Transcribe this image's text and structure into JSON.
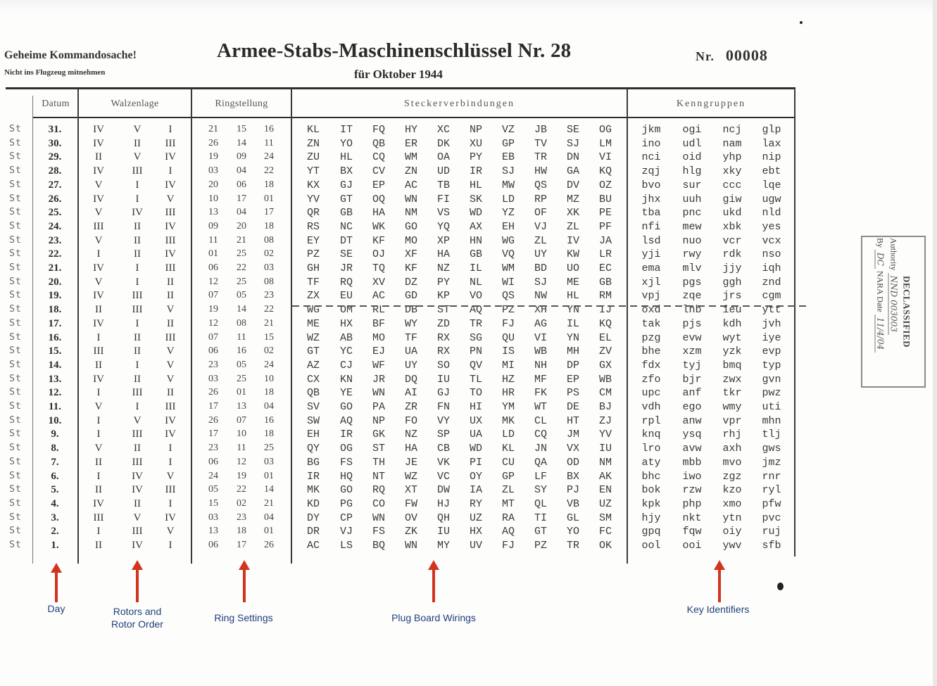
{
  "header": {
    "classification": "Geheime Kommandosache!",
    "notice": "Nicht ins Flugzeug mitnehmen",
    "title": "Armee-Stabs-Maschinenschlüssel Nr. 28",
    "subtitle": "für Oktober 1944",
    "number_label": "Nr.",
    "number_value": "00008"
  },
  "table": {
    "headers": {
      "datum": "Datum",
      "walzenlage": "Walzenlage",
      "ringstellung": "Ringstellung",
      "steckerverbindungen": "Steckerverbindungen",
      "kenngruppen": "Kenngruppen"
    },
    "row_prefix": "St",
    "rows": [
      {
        "day": "31.",
        "rotors": [
          "IV",
          "V",
          "I"
        ],
        "rings": [
          "21",
          "15",
          "16"
        ],
        "plugs": [
          "KL",
          "IT",
          "FQ",
          "HY",
          "XC",
          "NP",
          "VZ",
          "JB",
          "SE",
          "OG"
        ],
        "kenn": [
          "jkm",
          "ogi",
          "ncj",
          "glp"
        ]
      },
      {
        "day": "30.",
        "rotors": [
          "IV",
          "II",
          "III"
        ],
        "rings": [
          "26",
          "14",
          "11"
        ],
        "plugs": [
          "ZN",
          "YO",
          "QB",
          "ER",
          "DK",
          "XU",
          "GP",
          "TV",
          "SJ",
          "LM"
        ],
        "kenn": [
          "ino",
          "udl",
          "nam",
          "lax"
        ]
      },
      {
        "day": "29.",
        "rotors": [
          "II",
          "V",
          "IV"
        ],
        "rings": [
          "19",
          "09",
          "24"
        ],
        "plugs": [
          "ZU",
          "HL",
          "CQ",
          "WM",
          "OA",
          "PY",
          "EB",
          "TR",
          "DN",
          "VI"
        ],
        "kenn": [
          "nci",
          "oid",
          "yhp",
          "nip"
        ]
      },
      {
        "day": "28.",
        "rotors": [
          "IV",
          "III",
          "I"
        ],
        "rings": [
          "03",
          "04",
          "22"
        ],
        "plugs": [
          "YT",
          "BX",
          "CV",
          "ZN",
          "UD",
          "IR",
          "SJ",
          "HW",
          "GA",
          "KQ"
        ],
        "kenn": [
          "zqj",
          "hlg",
          "xky",
          "ebt"
        ]
      },
      {
        "day": "27.",
        "rotors": [
          "V",
          "I",
          "IV"
        ],
        "rings": [
          "20",
          "06",
          "18"
        ],
        "plugs": [
          "KX",
          "GJ",
          "EP",
          "AC",
          "TB",
          "HL",
          "MW",
          "QS",
          "DV",
          "OZ"
        ],
        "kenn": [
          "bvo",
          "sur",
          "ccc",
          "lqe"
        ]
      },
      {
        "day": "26.",
        "rotors": [
          "IV",
          "I",
          "V"
        ],
        "rings": [
          "10",
          "17",
          "01"
        ],
        "plugs": [
          "YV",
          "GT",
          "OQ",
          "WN",
          "FI",
          "SK",
          "LD",
          "RP",
          "MZ",
          "BU"
        ],
        "kenn": [
          "jhx",
          "uuh",
          "giw",
          "ugw"
        ]
      },
      {
        "day": "25.",
        "rotors": [
          "V",
          "IV",
          "III"
        ],
        "rings": [
          "13",
          "04",
          "17"
        ],
        "plugs": [
          "QR",
          "GB",
          "HA",
          "NM",
          "VS",
          "WD",
          "YZ",
          "OF",
          "XK",
          "PE"
        ],
        "kenn": [
          "tba",
          "pnc",
          "ukd",
          "nld"
        ]
      },
      {
        "day": "24.",
        "rotors": [
          "III",
          "II",
          "IV"
        ],
        "rings": [
          "09",
          "20",
          "18"
        ],
        "plugs": [
          "RS",
          "NC",
          "WK",
          "GO",
          "YQ",
          "AX",
          "EH",
          "VJ",
          "ZL",
          "PF"
        ],
        "kenn": [
          "nfi",
          "mew",
          "xbk",
          "yes"
        ]
      },
      {
        "day": "23.",
        "rotors": [
          "V",
          "II",
          "III"
        ],
        "rings": [
          "11",
          "21",
          "08"
        ],
        "plugs": [
          "EY",
          "DT",
          "KF",
          "MO",
          "XP",
          "HN",
          "WG",
          "ZL",
          "IV",
          "JA"
        ],
        "kenn": [
          "lsd",
          "nuo",
          "vcr",
          "vcx"
        ]
      },
      {
        "day": "22.",
        "rotors": [
          "I",
          "II",
          "IV"
        ],
        "rings": [
          "01",
          "25",
          "02"
        ],
        "plugs": [
          "PZ",
          "SE",
          "OJ",
          "XF",
          "HA",
          "GB",
          "VQ",
          "UY",
          "KW",
          "LR"
        ],
        "kenn": [
          "yji",
          "rwy",
          "rdk",
          "nso"
        ]
      },
      {
        "day": "21.",
        "rotors": [
          "IV",
          "I",
          "III"
        ],
        "rings": [
          "06",
          "22",
          "03"
        ],
        "plugs": [
          "GH",
          "JR",
          "TQ",
          "KF",
          "NZ",
          "IL",
          "WM",
          "BD",
          "UO",
          "EC"
        ],
        "kenn": [
          "ema",
          "mlv",
          "jjy",
          "iqh"
        ]
      },
      {
        "day": "20.",
        "rotors": [
          "V",
          "I",
          "II"
        ],
        "rings": [
          "12",
          "25",
          "08"
        ],
        "plugs": [
          "TF",
          "RQ",
          "XV",
          "DZ",
          "PY",
          "NL",
          "WI",
          "SJ",
          "ME",
          "GB"
        ],
        "kenn": [
          "xjl",
          "pgs",
          "ggh",
          "znd"
        ]
      },
      {
        "day": "19.",
        "rotors": [
          "IV",
          "III",
          "II"
        ],
        "rings": [
          "07",
          "05",
          "23"
        ],
        "plugs": [
          "ZX",
          "EU",
          "AC",
          "GD",
          "KP",
          "VO",
          "QS",
          "NW",
          "HL",
          "RM"
        ],
        "kenn": [
          "vpj",
          "zqe",
          "jrs",
          "cgm"
        ]
      },
      {
        "day": "18.",
        "rotors": [
          "II",
          "III",
          "V"
        ],
        "rings": [
          "19",
          "14",
          "22"
        ],
        "plugs": [
          "WG",
          "OM",
          "RL",
          "DB",
          "ST",
          "AQ",
          "PZ",
          "XH",
          "YN",
          "IJ"
        ],
        "kenn": [
          "oxd",
          "lnb",
          "ieu",
          "ytt"
        ]
      },
      {
        "day": "17.",
        "rotors": [
          "IV",
          "I",
          "II"
        ],
        "rings": [
          "12",
          "08",
          "21"
        ],
        "plugs": [
          "ME",
          "HX",
          "BF",
          "WY",
          "ZD",
          "TR",
          "FJ",
          "AG",
          "IL",
          "KQ"
        ],
        "kenn": [
          "tak",
          "pjs",
          "kdh",
          "jvh"
        ]
      },
      {
        "day": "16.",
        "rotors": [
          "I",
          "II",
          "III"
        ],
        "rings": [
          "07",
          "11",
          "15"
        ],
        "plugs": [
          "WZ",
          "AB",
          "MO",
          "TF",
          "RX",
          "SG",
          "QU",
          "VI",
          "YN",
          "EL"
        ],
        "kenn": [
          "pzg",
          "evw",
          "wyt",
          "iye"
        ]
      },
      {
        "day": "15.",
        "rotors": [
          "III",
          "II",
          "V"
        ],
        "rings": [
          "06",
          "16",
          "02"
        ],
        "plugs": [
          "GT",
          "YC",
          "EJ",
          "UA",
          "RX",
          "PN",
          "IS",
          "WB",
          "MH",
          "ZV"
        ],
        "kenn": [
          "bhe",
          "xzm",
          "yzk",
          "evp"
        ]
      },
      {
        "day": "14.",
        "rotors": [
          "II",
          "I",
          "V"
        ],
        "rings": [
          "23",
          "05",
          "24"
        ],
        "plugs": [
          "AZ",
          "CJ",
          "WF",
          "UY",
          "SO",
          "QV",
          "MI",
          "NH",
          "DP",
          "GX"
        ],
        "kenn": [
          "fdx",
          "tyj",
          "bmq",
          "typ"
        ]
      },
      {
        "day": "13.",
        "rotors": [
          "IV",
          "II",
          "V"
        ],
        "rings": [
          "03",
          "25",
          "10"
        ],
        "plugs": [
          "CX",
          "KN",
          "JR",
          "DQ",
          "IU",
          "TL",
          "HZ",
          "MF",
          "EP",
          "WB"
        ],
        "kenn": [
          "zfo",
          "bjr",
          "zwx",
          "gvn"
        ]
      },
      {
        "day": "12.",
        "rotors": [
          "I",
          "III",
          "II"
        ],
        "rings": [
          "26",
          "01",
          "18"
        ],
        "plugs": [
          "QB",
          "YE",
          "WN",
          "AI",
          "GJ",
          "TO",
          "HR",
          "FK",
          "PS",
          "CM"
        ],
        "kenn": [
          "upc",
          "anf",
          "tkr",
          "pwz"
        ]
      },
      {
        "day": "11.",
        "rotors": [
          "V",
          "I",
          "III"
        ],
        "rings": [
          "17",
          "13",
          "04"
        ],
        "plugs": [
          "SV",
          "GO",
          "PA",
          "ZR",
          "FN",
          "HI",
          "YM",
          "WT",
          "DE",
          "BJ"
        ],
        "kenn": [
          "vdh",
          "ego",
          "wmy",
          "uti"
        ]
      },
      {
        "day": "10.",
        "rotors": [
          "I",
          "V",
          "IV"
        ],
        "rings": [
          "26",
          "07",
          "16"
        ],
        "plugs": [
          "SW",
          "AQ",
          "NP",
          "FO",
          "VY",
          "UX",
          "MK",
          "CL",
          "HT",
          "ZJ"
        ],
        "kenn": [
          "rpl",
          "anw",
          "vpr",
          "mhn"
        ]
      },
      {
        "day": "9.",
        "rotors": [
          "I",
          "III",
          "IV"
        ],
        "rings": [
          "17",
          "10",
          "18"
        ],
        "plugs": [
          "EH",
          "IR",
          "GK",
          "NZ",
          "SP",
          "UA",
          "LD",
          "CQ",
          "JM",
          "YV"
        ],
        "kenn": [
          "knq",
          "ysq",
          "rhj",
          "tlj"
        ]
      },
      {
        "day": "8.",
        "rotors": [
          "V",
          "II",
          "I"
        ],
        "rings": [
          "23",
          "11",
          "25"
        ],
        "plugs": [
          "QY",
          "OG",
          "ST",
          "HA",
          "CB",
          "WD",
          "KL",
          "JN",
          "VX",
          "IU"
        ],
        "kenn": [
          "lro",
          "avw",
          "axh",
          "gws"
        ]
      },
      {
        "day": "7.",
        "rotors": [
          "II",
          "III",
          "I"
        ],
        "rings": [
          "06",
          "12",
          "03"
        ],
        "plugs": [
          "BG",
          "FS",
          "TH",
          "JE",
          "VK",
          "PI",
          "CU",
          "QA",
          "OD",
          "NM"
        ],
        "kenn": [
          "aty",
          "mbb",
          "mvo",
          "jmz"
        ]
      },
      {
        "day": "6.",
        "rotors": [
          "I",
          "IV",
          "V"
        ],
        "rings": [
          "24",
          "19",
          "01"
        ],
        "plugs": [
          "IR",
          "HQ",
          "NT",
          "WZ",
          "VC",
          "OY",
          "GP",
          "LF",
          "BX",
          "AK"
        ],
        "kenn": [
          "bhc",
          "iwo",
          "zgz",
          "rnr"
        ]
      },
      {
        "day": "5.",
        "rotors": [
          "II",
          "IV",
          "III"
        ],
        "rings": [
          "05",
          "22",
          "14"
        ],
        "plugs": [
          "MK",
          "GO",
          "RQ",
          "XT",
          "DW",
          "IA",
          "ZL",
          "SY",
          "PJ",
          "EN"
        ],
        "kenn": [
          "bok",
          "rzw",
          "kzo",
          "ryl"
        ]
      },
      {
        "day": "4.",
        "rotors": [
          "IV",
          "II",
          "I"
        ],
        "rings": [
          "15",
          "02",
          "21"
        ],
        "plugs": [
          "KD",
          "PG",
          "CO",
          "FW",
          "HJ",
          "RY",
          "MT",
          "QL",
          "VB",
          "UZ"
        ],
        "kenn": [
          "kpk",
          "php",
          "xmo",
          "pfw"
        ]
      },
      {
        "day": "3.",
        "rotors": [
          "III",
          "V",
          "IV"
        ],
        "rings": [
          "03",
          "23",
          "04"
        ],
        "plugs": [
          "DY",
          "CP",
          "WN",
          "OV",
          "QH",
          "UZ",
          "RA",
          "TI",
          "GL",
          "SM"
        ],
        "kenn": [
          "hjy",
          "nkt",
          "ytn",
          "pvc"
        ]
      },
      {
        "day": "2.",
        "rotors": [
          "I",
          "III",
          "V"
        ],
        "rings": [
          "13",
          "18",
          "01"
        ],
        "plugs": [
          "DR",
          "VJ",
          "FS",
          "ZK",
          "IU",
          "HX",
          "AQ",
          "GT",
          "YO",
          "FC"
        ],
        "kenn": [
          "gpq",
          "fqw",
          "oiy",
          "ruj"
        ]
      },
      {
        "day": "1.",
        "rotors": [
          "II",
          "IV",
          "I"
        ],
        "rings": [
          "06",
          "17",
          "26"
        ],
        "plugs": [
          "AC",
          "LS",
          "BQ",
          "WN",
          "MY",
          "UV",
          "FJ",
          "PZ",
          "TR",
          "OK"
        ],
        "kenn": [
          "ool",
          "ooi",
          "ywv",
          "sfb"
        ]
      }
    ],
    "struck_day": "18."
  },
  "stamp": {
    "title": "DECLASSIFIED",
    "authority_label": "Authority",
    "authority_value": "NND 003003",
    "by_label": "By",
    "by_value": "DC",
    "nara_label": "NARA Date",
    "date_value": "11/4/04"
  },
  "annotations": {
    "day": "Day",
    "rotors_line1": "Rotors and",
    "rotors_line2": "Rotor Order",
    "ring": "Ring Settings",
    "plug": "Plug Board Wirings",
    "key": "Key Identifiers",
    "arrow_color": "#d2341e",
    "text_color": "#1f3f7a"
  }
}
